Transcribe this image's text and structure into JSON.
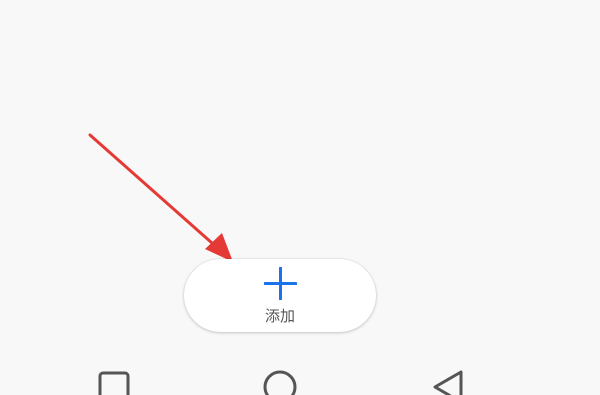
{
  "add_button": {
    "label": "添加",
    "icon": "plus-icon",
    "icon_color": "#1a73e8"
  },
  "annotation": {
    "type": "arrow",
    "color": "#e53935"
  },
  "navbar": {
    "items": [
      {
        "icon": "recent-apps-icon"
      },
      {
        "icon": "home-icon"
      },
      {
        "icon": "back-icon"
      }
    ],
    "icon_color": "#555555"
  }
}
